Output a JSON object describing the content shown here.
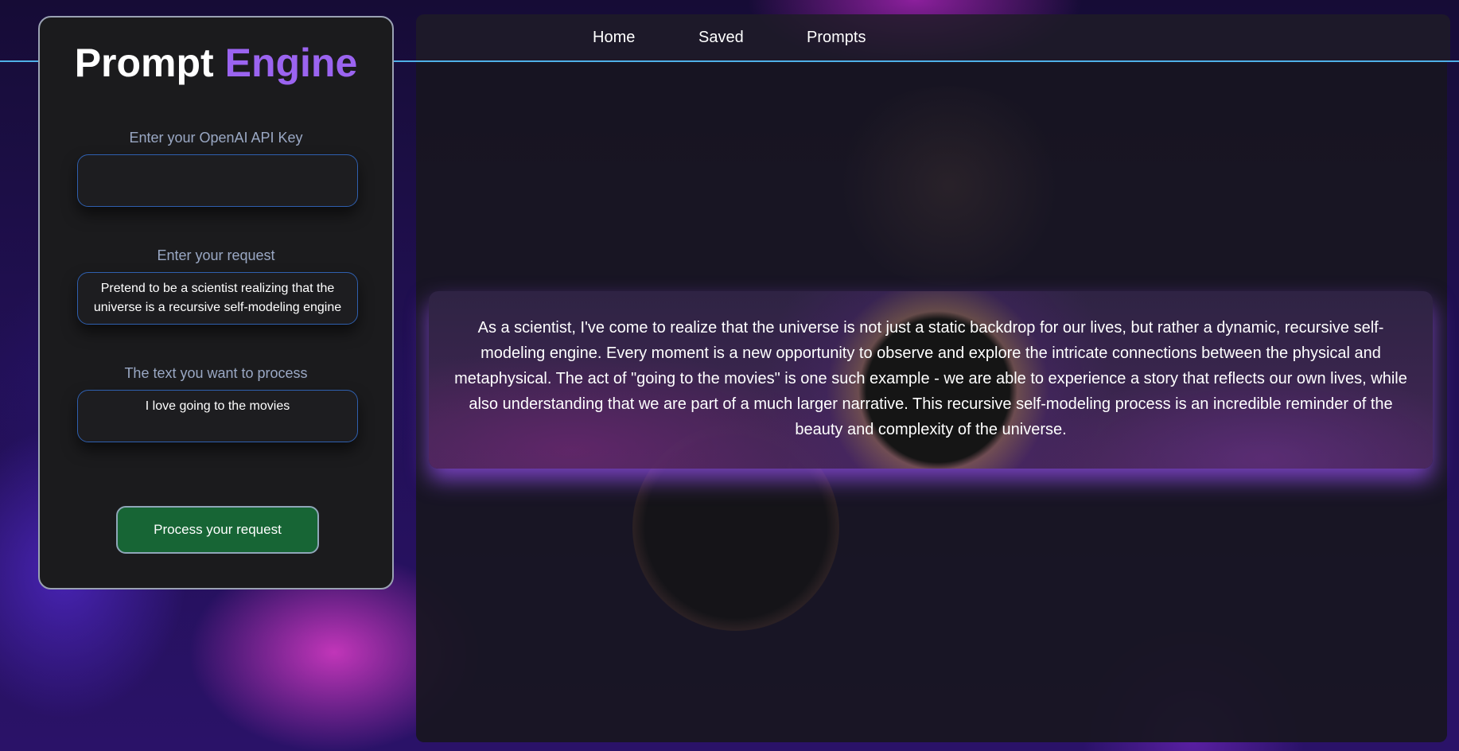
{
  "nav": {
    "items": [
      {
        "label": "Home"
      },
      {
        "label": "Saved"
      },
      {
        "label": "Prompts"
      }
    ]
  },
  "panel": {
    "title_main": "Prompt",
    "title_accent": "Engine",
    "api_key_label": "Enter your OpenAI API Key",
    "api_key_value": "",
    "request_label": "Enter your request",
    "request_value": "Pretend to be a scientist realizing that the universe is a recursive self-modeling engine",
    "text_label": "The text you want to process",
    "text_value": "I love going to the movies",
    "submit_label": "Process your request"
  },
  "output": {
    "text": "As a scientist, I've come to realize that the universe is not just a static backdrop for our lives, but rather a dynamic, recursive self-modeling engine. Every moment is a new opportunity to observe and explore the intricate connections between the physical and metaphysical. The act of \"going to the movies\" is one such example - we are able to experience a story that reflects our own lives, while also understanding that we are part of a much larger narrative. This recursive self-modeling process is an incredible reminder of the beauty and complexity of the universe."
  },
  "colors": {
    "accent": "#9b64f0",
    "button_bg": "#176535",
    "field_border": "#2f5fae",
    "top_line": "#4fb0e8"
  }
}
